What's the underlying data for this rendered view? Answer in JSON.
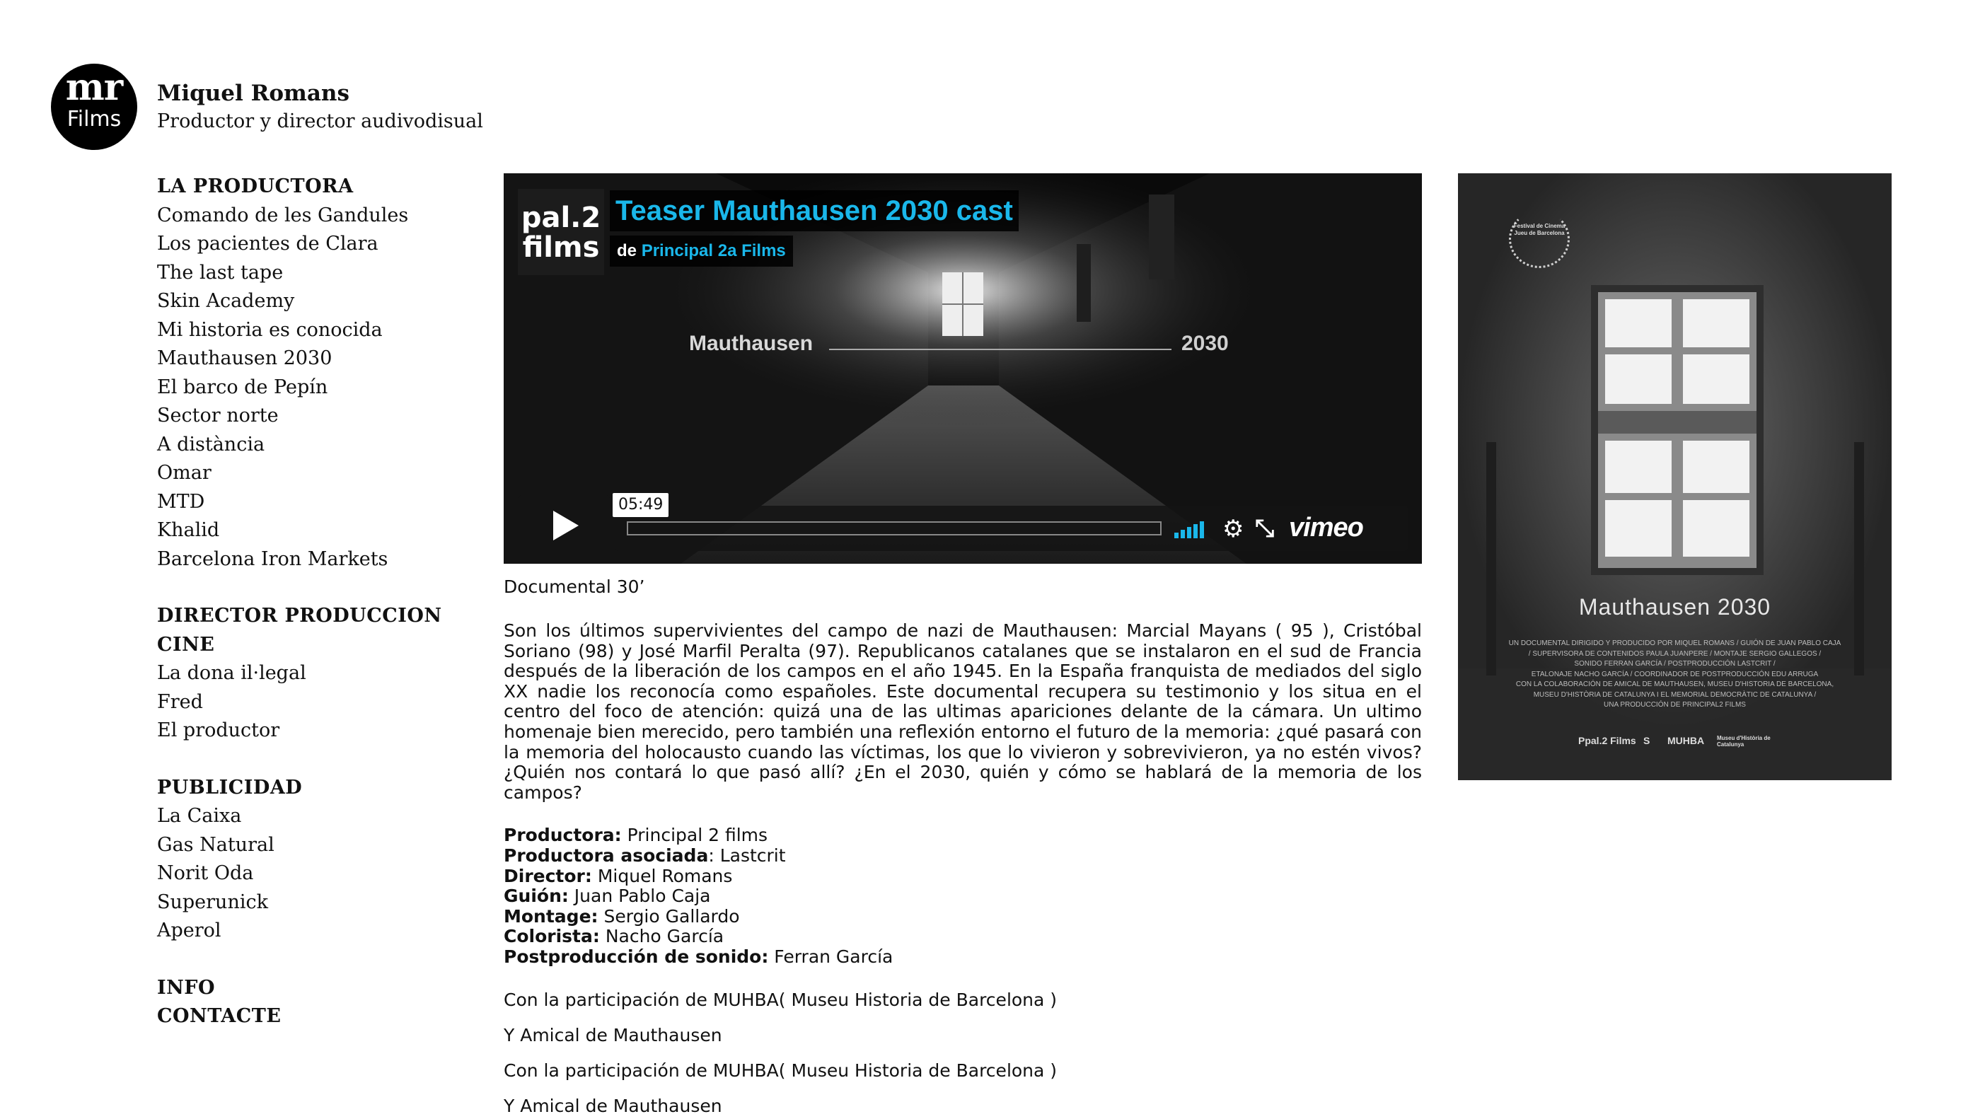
{
  "site": {
    "logo_top": "mr",
    "logo_bottom": "Films",
    "title": "Miquel Romans",
    "subtitle": "Productor y director audivodisual"
  },
  "nav": {
    "sections": [
      {
        "heading": "LA PRODUCTORA",
        "items": [
          "Comando de les Gandules",
          "Los pacientes de Clara",
          "The last tape",
          "Skin Academy",
          "Mi historia es conocida",
          "Mauthausen 2030",
          "El barco de Pepín",
          "Sector norte",
          "A distància",
          "Omar",
          "MTD",
          "Khalid",
          "Barcelona Iron Markets"
        ]
      },
      {
        "heading": "DIRECTOR PRODUCCION CINE",
        "items": [
          "La dona il·legal",
          "Fred",
          "El productor"
        ]
      },
      {
        "heading": "PUBLICIDAD",
        "items": [
          "La Caixa",
          "Gas Natural",
          "Norit Oda",
          "Superunick",
          "Aperol"
        ]
      }
    ],
    "info": "INFO",
    "contact": "CONTACTE"
  },
  "video": {
    "channel_logo": "pal.2\nfilms",
    "title": "Teaser Mauthausen 2030 cast",
    "by_prefix": "de",
    "by_name": "Principal 2a Films",
    "overlay_left": "Mauthausen",
    "overlay_right": "2030",
    "duration": "05:49",
    "brand": "vimeo",
    "accent_color": "#1ab7ea"
  },
  "content": {
    "type": "Documental 30’",
    "description": "Son los últimos supervivientes del campo de nazi de Mauthausen: Marcial Mayans ( 95 ), Cristóbal Soriano (98) y José Marfil Peralta (97). Republicanos catalanes que se instalaron en el sud de Francia después de la liberación de los campos en el año 1945. En la España franquista de mediados del siglo XX nadie los reconocía como españoles. Este documental recupera su testimonio y los situa en el centro del foco de atención: quizá una de las ultimas apariciones delante de la cámara. Un ultimo homenaje bien merecido, pero también una reflexión entorno el futuro de la memoria: ¿qué pasará con la memoria del holocausto cuando las víctimas, los que lo vivieron y sobrevivieron, ya no estén vivos? ¿Quién nos contará lo que pasó allí? ¿En el 2030, quién y cómo se hablará de la memoria de los campos?",
    "credits": [
      {
        "label": "Productora:",
        "value": " Principal 2 films"
      },
      {
        "label": "Productora asociada",
        "value": ": Lastcrit"
      },
      {
        "label": "Director:",
        "value": " Miquel Romans"
      },
      {
        "label": "Guión:",
        "value": " Juan Pablo Caja"
      },
      {
        "label": "Montage:",
        "value": " Sergio Gallardo"
      },
      {
        "label": "Colorista:",
        "value": " Nacho García"
      },
      {
        "label": "Postproducción de sonido:",
        "value": " Ferran García"
      }
    ],
    "notes": [
      "Con la participación de MUHBA( Museu Historia de Barcelona )",
      "Y Amical de Mauthausen",
      "Con la participación de MUHBA( Museu Historia de Barcelona )",
      "Y Amical de Mauthausen"
    ]
  },
  "poster": {
    "laurel_text": "Festival de Cinema Jueu de Barcelona",
    "title": "Mauthausen 2030",
    "credit_lines": [
      "Un documental dirigido y producido por Miquel Romans / Guión de Juan Pablo Caja",
      "/ Supervisora de contenidos Paula Juanpere / Montaje Sergio Gallegos /",
      "Sonido Ferran García / Postproducción Lastcrit /",
      "Etalonaje Nacho García / Coordinador de postproducción Edu Arruga",
      "Con la colaboración de Amical de Mauthausen, Museu d'Historia de Barcelona,",
      "Museu d'Història de Catalunya i el Memorial Democràtic de Catalunya /",
      "Una producción de Principal2 Films"
    ],
    "logos": [
      "Ppal.2 Films",
      "S",
      "MUHBA",
      "Museu d'Història de Catalunya"
    ]
  }
}
